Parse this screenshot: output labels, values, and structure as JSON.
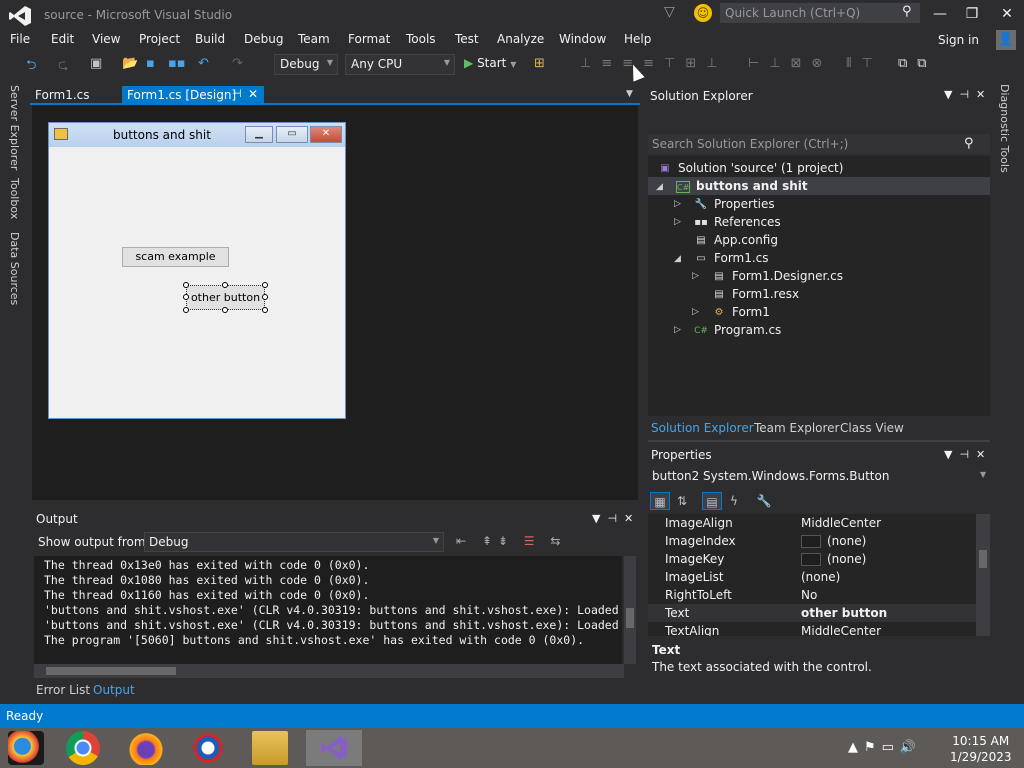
{
  "window": {
    "title": "source - Microsoft Visual Studio",
    "quick_launch_placeholder": "Quick Launch (Ctrl+Q)",
    "controls": {
      "minimize": "—",
      "restore": "❐",
      "close": "✕"
    }
  },
  "menu": {
    "items": [
      "File",
      "Edit",
      "View",
      "Project",
      "Build",
      "Debug",
      "Team",
      "Format",
      "Tools",
      "Test",
      "Analyze",
      "Window",
      "Help"
    ],
    "sign_in": "Sign in"
  },
  "toolbar": {
    "config": "Debug",
    "platform": "Any CPU",
    "start_label": "Start"
  },
  "side_tabs": [
    "Server Explorer",
    "Toolbox",
    "Data Sources"
  ],
  "doc_tabs": [
    {
      "label": "Form1.cs",
      "active": false
    },
    {
      "label": "Form1.cs [Design]",
      "active": true
    }
  ],
  "designer": {
    "form_title": "buttons and shit",
    "button1": "scam example",
    "button2": "other button"
  },
  "output": {
    "title": "Output",
    "show_output_label": "Show output from:",
    "source": "Debug",
    "lines": [
      "The thread 0x13e0 has exited with code 0 (0x0).",
      "The thread 0x1080 has exited with code 0 (0x0).",
      "The thread 0x1160 has exited with code 0 (0x0).",
      "'buttons and shit.vshost.exe' (CLR v4.0.30319: buttons and shit.vshost.exe): Loaded",
      "'buttons and shit.vshost.exe' (CLR v4.0.30319: buttons and shit.vshost.exe): Loaded",
      "The program '[5060] buttons and shit.vshost.exe' has exited with code 0 (0x0)."
    ],
    "bottom_tabs": [
      "Error List",
      "Output"
    ]
  },
  "solution_explorer": {
    "title": "Solution Explorer",
    "search_placeholder": "Search Solution Explorer (Ctrl+;)",
    "tree": [
      {
        "label": "Solution 'source' (1 project)",
        "level": 0,
        "expander": "",
        "icon": "solution-icon",
        "bold": false
      },
      {
        "label": "buttons and shit",
        "level": 0,
        "expander": "◢",
        "icon": "csharp-project-icon",
        "bold": true
      },
      {
        "label": "Properties",
        "level": 1,
        "expander": "▷",
        "icon": "wrench-icon",
        "bold": false
      },
      {
        "label": "References",
        "level": 1,
        "expander": "▷",
        "icon": "references-icon",
        "bold": false
      },
      {
        "label": "App.config",
        "level": 1,
        "expander": "",
        "icon": "config-file-icon",
        "bold": false
      },
      {
        "label": "Form1.cs",
        "level": 1,
        "expander": "◢",
        "icon": "form-icon",
        "bold": false
      },
      {
        "label": "Form1.Designer.cs",
        "level": 2,
        "expander": "▷",
        "icon": "cs-file-icon",
        "bold": false
      },
      {
        "label": "Form1.resx",
        "level": 2,
        "expander": "",
        "icon": "resx-file-icon",
        "bold": false
      },
      {
        "label": "Form1",
        "level": 2,
        "expander": "▷",
        "icon": "class-icon",
        "bold": false
      },
      {
        "label": "Program.cs",
        "level": 1,
        "expander": "▷",
        "icon": "csharp-file-icon",
        "bold": false
      }
    ],
    "bottom_tabs": [
      "Solution Explorer",
      "Team Explorer",
      "Class View"
    ]
  },
  "properties": {
    "title": "Properties",
    "object": "button2  System.Windows.Forms.Button",
    "rows": [
      {
        "name": "ImageAlign",
        "value": "MiddleCenter",
        "swatch": false,
        "bold": false
      },
      {
        "name": "ImageIndex",
        "value": "(none)",
        "swatch": true,
        "bold": false
      },
      {
        "name": "ImageKey",
        "value": "(none)",
        "swatch": true,
        "bold": false
      },
      {
        "name": "ImageList",
        "value": "(none)",
        "swatch": false,
        "bold": false
      },
      {
        "name": "RightToLeft",
        "value": "No",
        "swatch": false,
        "bold": false
      },
      {
        "name": "Text",
        "value": "other button",
        "swatch": false,
        "bold": true
      },
      {
        "name": "TextAlign",
        "value": "MiddleCenter",
        "swatch": false,
        "bold": false
      }
    ],
    "desc_title": "Text",
    "desc_text": "The text associated with the control."
  },
  "diagnostic_tab": "Diagnostic Tools",
  "status": "Ready",
  "taskbar": {
    "time": "10:15 AM",
    "date": "1/29/2023",
    "apps": [
      "media-app-icon",
      "chrome-icon",
      "firefox-icon",
      "obama-icon",
      "file-explorer-icon",
      "visual-studio-icon"
    ]
  },
  "colors": {
    "accent": "#007acc",
    "bg": "#2d2d30",
    "editor": "#1e1e1e"
  }
}
